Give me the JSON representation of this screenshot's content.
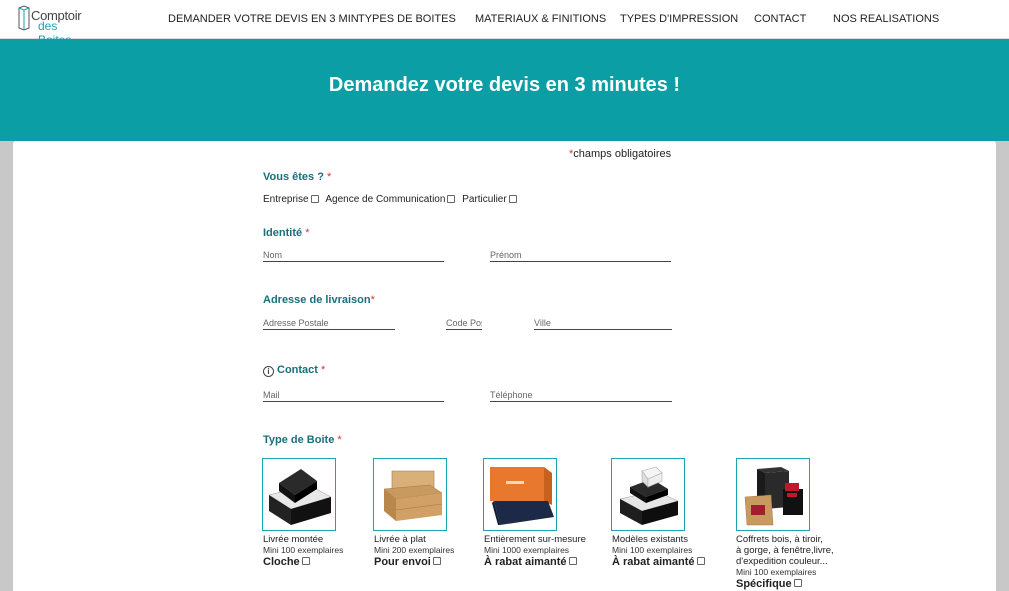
{
  "logo": {
    "line1": "Comptoir",
    "line2": "des Boites"
  },
  "nav": [
    "DEMANDER VOTRE DEVIS EN 3 MIN",
    "TYPES DE BOITES",
    "MATERIAUX & FINITIONS",
    "TYPES D'IMPRESSION",
    "CONTACT",
    "NOS REALISATIONS"
  ],
  "banner": {
    "title": "Demandez votre devis en 3 minutes !"
  },
  "required_note": {
    "star": "*",
    "text": "champs obligatoires"
  },
  "vous_etes": {
    "title": "Vous êtes ?",
    "star": "*",
    "options": [
      "Entreprise",
      "Agence de Communication",
      "Particulier"
    ]
  },
  "identite": {
    "title": "Identité",
    "star": "*",
    "nom_placeholder": "Nom",
    "prenom_placeholder": "Prénom"
  },
  "adresse": {
    "title": "Adresse de livraison",
    "star": "*",
    "postale_placeholder": "Adresse Postale",
    "code_placeholder": "Code Postal",
    "ville_placeholder": "Ville"
  },
  "contact": {
    "icon": "info-icon",
    "title": "Contact",
    "star": "*",
    "mail_placeholder": "Mail",
    "tel_placeholder": "Téléphone"
  },
  "type_boite": {
    "title": "Type de Boite",
    "star": "*",
    "items": [
      {
        "label": "Livrée montée",
        "mini": "Mini 100 exemplaires",
        "strong": "Cloche"
      },
      {
        "label": "Livrée à plat",
        "mini": "Mini 200 exemplaires",
        "strong": "Pour envoi"
      },
      {
        "label": "Entièrement sur-mesure",
        "mini": "Mini 1000 exemplaires",
        "strong": "À rabat aimanté"
      },
      {
        "label": "Modèles existants",
        "mini": "Mini 100 exemplaires",
        "strong": "À rabat aimanté"
      },
      {
        "label_lines": [
          "Coffrets bois, à tiroir,",
          "à gorge, à fenêtre,livre,",
          "d'expedition couleur..."
        ],
        "mini": "Mini 100 exemplaires",
        "strong": "Spécifique"
      }
    ]
  },
  "colors": {
    "accent": "#0b9ea5",
    "section_title": "#1b6e7c",
    "required": "#dd3333"
  }
}
